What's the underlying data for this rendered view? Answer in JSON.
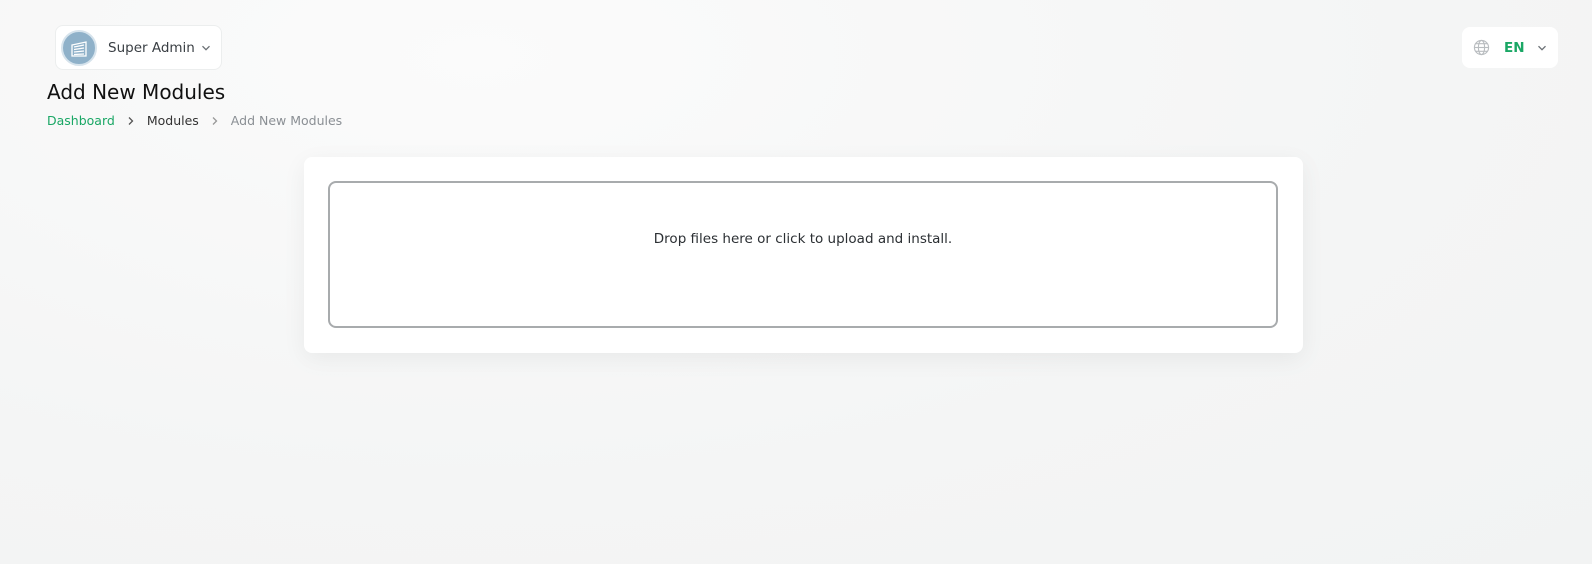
{
  "header": {
    "user": {
      "name": "Super Admin",
      "avatar_icon": "building-icon"
    },
    "language": {
      "code": "EN",
      "icon": "globe-icon"
    }
  },
  "page": {
    "title": "Add New Modules",
    "breadcrumb": [
      {
        "label": "Dashboard"
      },
      {
        "label": "Modules"
      },
      {
        "label": "Add New Modules"
      }
    ]
  },
  "upload": {
    "dropzone_text": "Drop files here or click to upload and install."
  },
  "colors": {
    "accent": "#1aa765",
    "background": "#f5f6f6",
    "card": "#ffffff"
  }
}
